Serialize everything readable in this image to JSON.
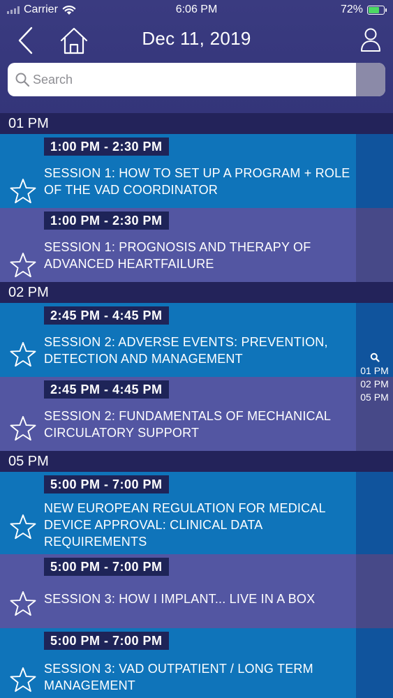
{
  "status_bar": {
    "carrier": "Carrier",
    "time": "6:06 PM",
    "battery": "72%"
  },
  "nav": {
    "title": "Dec 11, 2019"
  },
  "search": {
    "placeholder": "Search"
  },
  "sections": [
    {
      "label": "01 PM",
      "sessions": [
        {
          "time": "1:00 PM - 2:30 PM",
          "title": "SESSION 1: HOW TO SET UP A PROGRAM + ROLE OF THE VAD COORDINATOR"
        },
        {
          "time": "1:00 PM - 2:30 PM",
          "title": "SESSION 1: PROGNOSIS AND THERAPY OF ADVANCED HEARTFAILURE"
        }
      ]
    },
    {
      "label": "02 PM",
      "sessions": [
        {
          "time": "2:45 PM - 4:45 PM",
          "title": "SESSION 2: ADVERSE EVENTS: PREVENTION, DETECTION AND MANAGEMENT"
        },
        {
          "time": "2:45 PM - 4:45 PM",
          "title": "SESSION 2: FUNDAMENTALS OF MECHANICAL CIRCULATORY SUPPORT"
        }
      ]
    },
    {
      "label": "05 PM",
      "sessions": [
        {
          "time": "5:00 PM - 7:00 PM",
          "title": "NEW EUROPEAN REGULATION FOR MEDICAL DEVICE APPROVAL: CLINICAL DATA REQUIREMENTS"
        },
        {
          "time": "5:00 PM - 7:00 PM",
          "title": "SESSION 3: HOW I IMPLANT... LIVE IN A BOX"
        },
        {
          "time": "5:00 PM - 7:00 PM",
          "title": "SESSION 3: VAD OUTPATIENT / LONG TERM MANAGEMENT"
        }
      ]
    }
  ],
  "section_index": [
    "01 PM",
    "02 PM",
    "05 PM"
  ],
  "colors": {
    "header": "#3a3b80",
    "section": "#23235a",
    "row_blue": "#0f74ba",
    "row_purple": "#5356a2",
    "time_badge": "#1e2458"
  }
}
